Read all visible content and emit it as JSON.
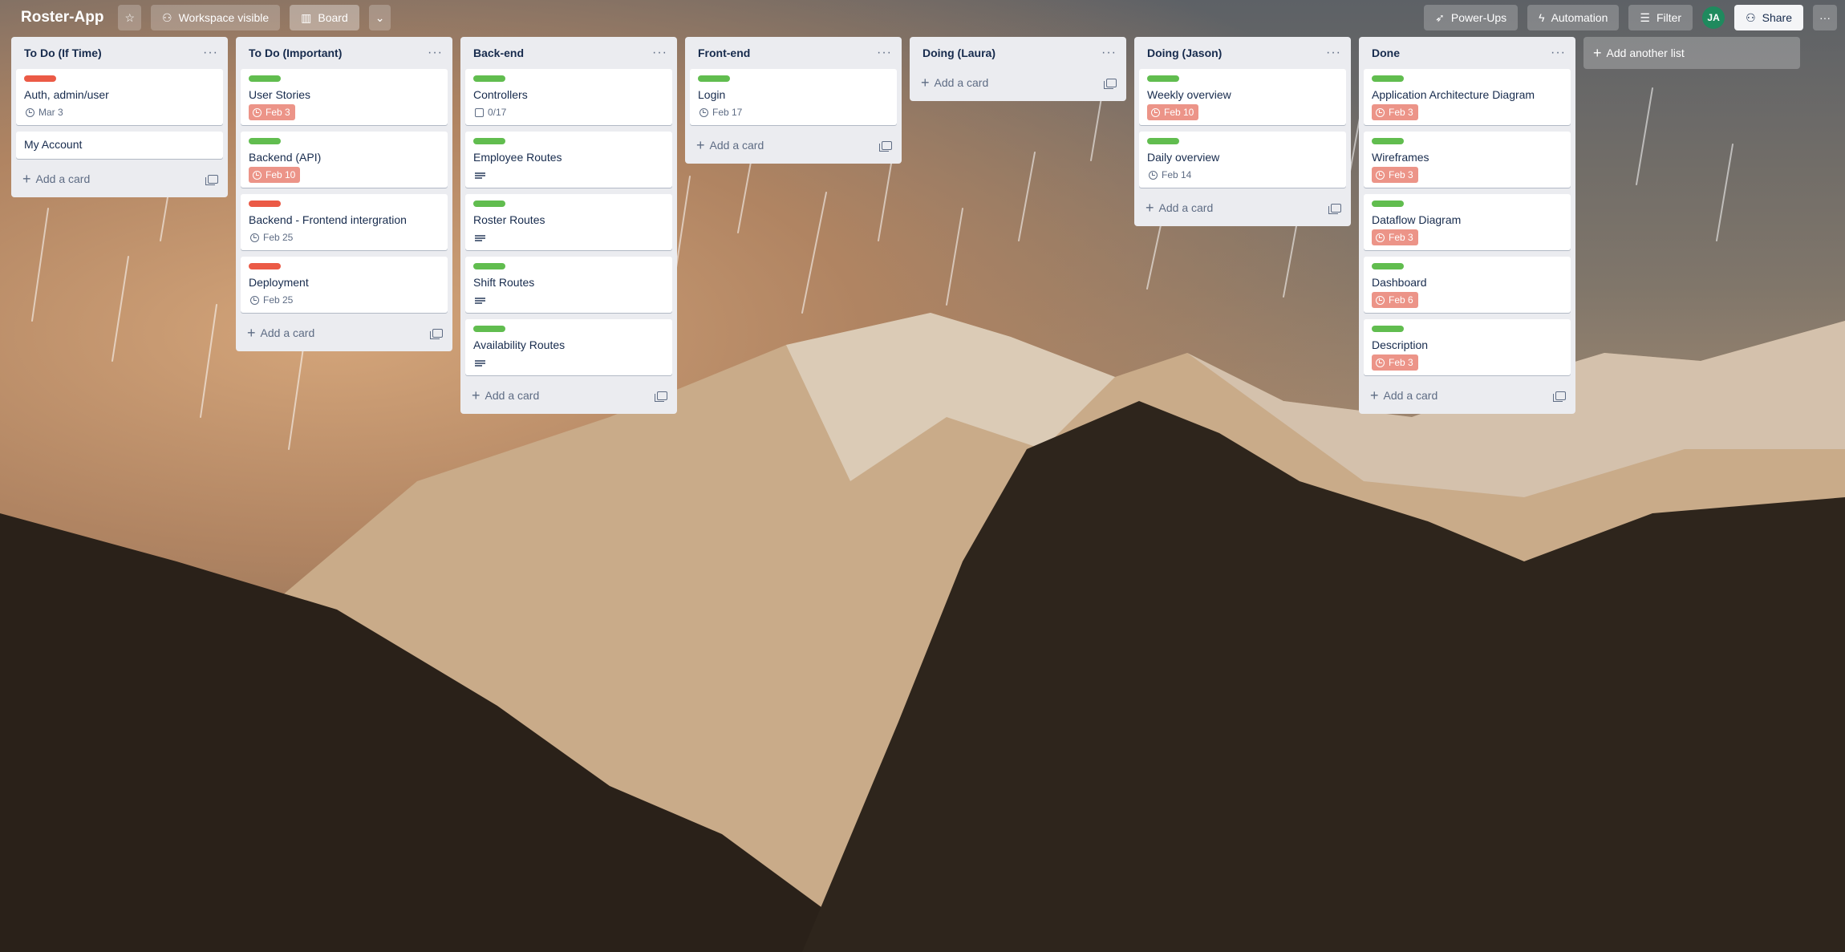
{
  "header": {
    "title": "Roster-App",
    "visibility_label": "Workspace visible",
    "view_label": "Board",
    "powerups_label": "Power-Ups",
    "automation_label": "Automation",
    "filter_label": "Filter",
    "avatar_initials": "JA",
    "share_label": "Share"
  },
  "lists": [
    {
      "title": "To Do (If Time)",
      "add_label": "Add a card",
      "cards": [
        {
          "label": "red",
          "title": "Auth, admin/user",
          "due": "Mar 3",
          "due_style": "normal"
        },
        {
          "label": null,
          "title": "My Account"
        }
      ]
    },
    {
      "title": "To Do (Important)",
      "add_label": "Add a card",
      "cards": [
        {
          "label": "green",
          "title": "User Stories",
          "due": "Feb 3",
          "due_style": "overdue"
        },
        {
          "label": "green",
          "title": "Backend (API)",
          "due": "Feb 10",
          "due_style": "overdue"
        },
        {
          "label": "red",
          "title": "Backend - Frontend intergration",
          "due": "Feb 25",
          "due_style": "normal"
        },
        {
          "label": "red",
          "title": "Deployment",
          "due": "Feb 25",
          "due_style": "normal"
        }
      ]
    },
    {
      "title": "Back-end",
      "add_label": "Add a card",
      "cards": [
        {
          "label": "green",
          "title": "Controllers",
          "checklist": "0/17"
        },
        {
          "label": "green",
          "title": "Employee Routes",
          "description": true
        },
        {
          "label": "green",
          "title": "Roster Routes",
          "description": true
        },
        {
          "label": "green",
          "title": "Shift Routes",
          "description": true
        },
        {
          "label": "green",
          "title": "Availability Routes",
          "description": true
        }
      ]
    },
    {
      "title": "Front-end",
      "add_label": "Add a card",
      "cards": [
        {
          "label": "green",
          "title": "Login",
          "due": "Feb 17",
          "due_style": "normal"
        }
      ]
    },
    {
      "title": "Doing (Laura)",
      "add_label": "Add a card",
      "cards": []
    },
    {
      "title": "Doing (Jason)",
      "add_label": "Add a card",
      "cards": [
        {
          "label": "green",
          "title": "Weekly overview",
          "due": "Feb 10",
          "due_style": "overdue"
        },
        {
          "label": "green",
          "title": "Daily overview",
          "due": "Feb 14",
          "due_style": "normal"
        }
      ]
    },
    {
      "title": "Done",
      "add_label": "Add a card",
      "cards": [
        {
          "label": "green",
          "title": "Application Architecture Diagram",
          "due": "Feb 3",
          "due_style": "overdue"
        },
        {
          "label": "green",
          "title": "Wireframes",
          "due": "Feb 3",
          "due_style": "overdue"
        },
        {
          "label": "green",
          "title": "Dataflow Diagram",
          "due": "Feb 3",
          "due_style": "overdue"
        },
        {
          "label": "green",
          "title": "Dashboard",
          "due": "Feb 6",
          "due_style": "overdue"
        },
        {
          "label": "green",
          "title": "Description",
          "due": "Feb 3",
          "due_style": "overdue"
        }
      ]
    }
  ],
  "add_list_label": "Add another list",
  "colors": {
    "label_green": "#61bd4f",
    "label_red": "#eb5a46",
    "overdue": "#ec9488",
    "list_bg": "#ebecf0"
  },
  "icons": [
    "star-icon",
    "people-icon",
    "board-icon",
    "chevron-down-icon",
    "rocket-icon",
    "bolt-icon",
    "filter-icon",
    "share-icon",
    "more-icon",
    "clock-icon",
    "checklist-icon",
    "description-icon",
    "template-icon",
    "plus-icon"
  ]
}
